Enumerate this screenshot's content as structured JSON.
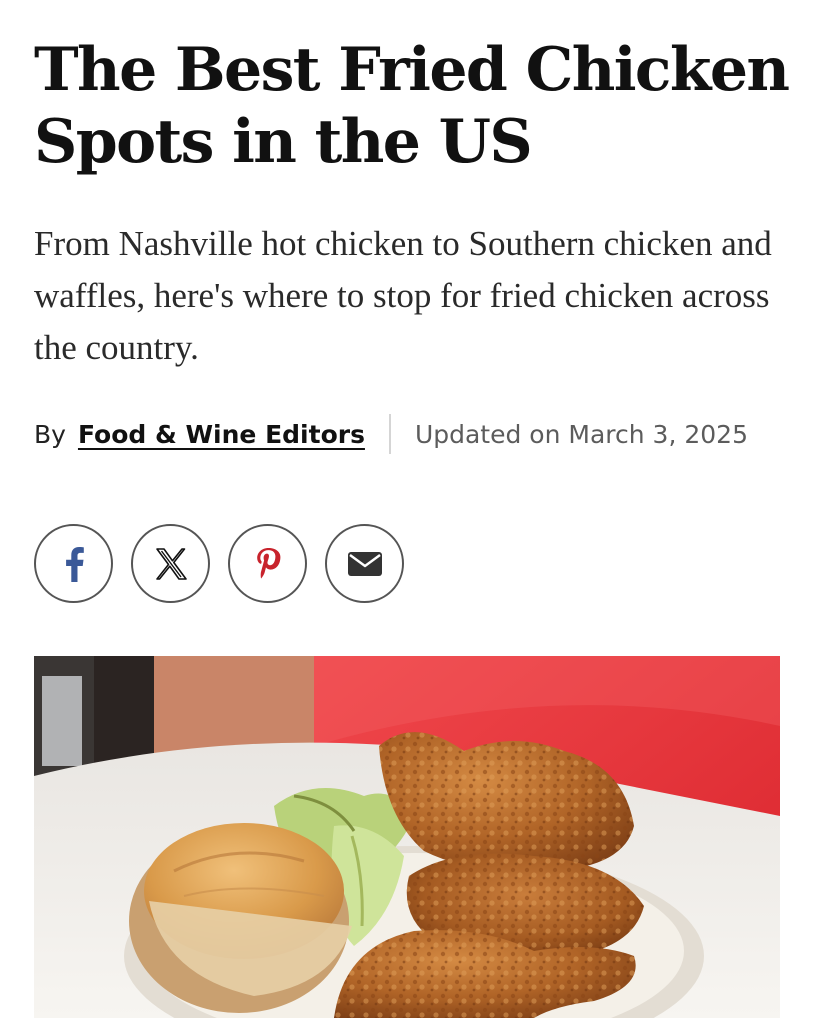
{
  "article": {
    "title": "The Best Fried Chicken Spots in the US",
    "dek": "From Nashville hot chicken to Southern chicken and waffles, here's where to stop for fried chicken across the country.",
    "byline": {
      "prefix": "By",
      "author": "Food & Wine Editors",
      "updated": "Updated on March 3, 2025"
    }
  },
  "share": {
    "buttons": [
      {
        "icon": "facebook-icon",
        "color": "#3b5998"
      },
      {
        "icon": "x-icon",
        "color": "#111111"
      },
      {
        "icon": "pinterest-icon",
        "color": "#c8232c"
      },
      {
        "icon": "email-icon",
        "color": "#333333"
      }
    ]
  },
  "hero_image": {
    "subject": "plate of fried chicken with a biscuit and salad on a red background",
    "colors": {
      "background_red": "#e8323a",
      "plate": "#f2efe9",
      "chicken": "#b5692b",
      "biscuit": "#d9a35a"
    }
  }
}
